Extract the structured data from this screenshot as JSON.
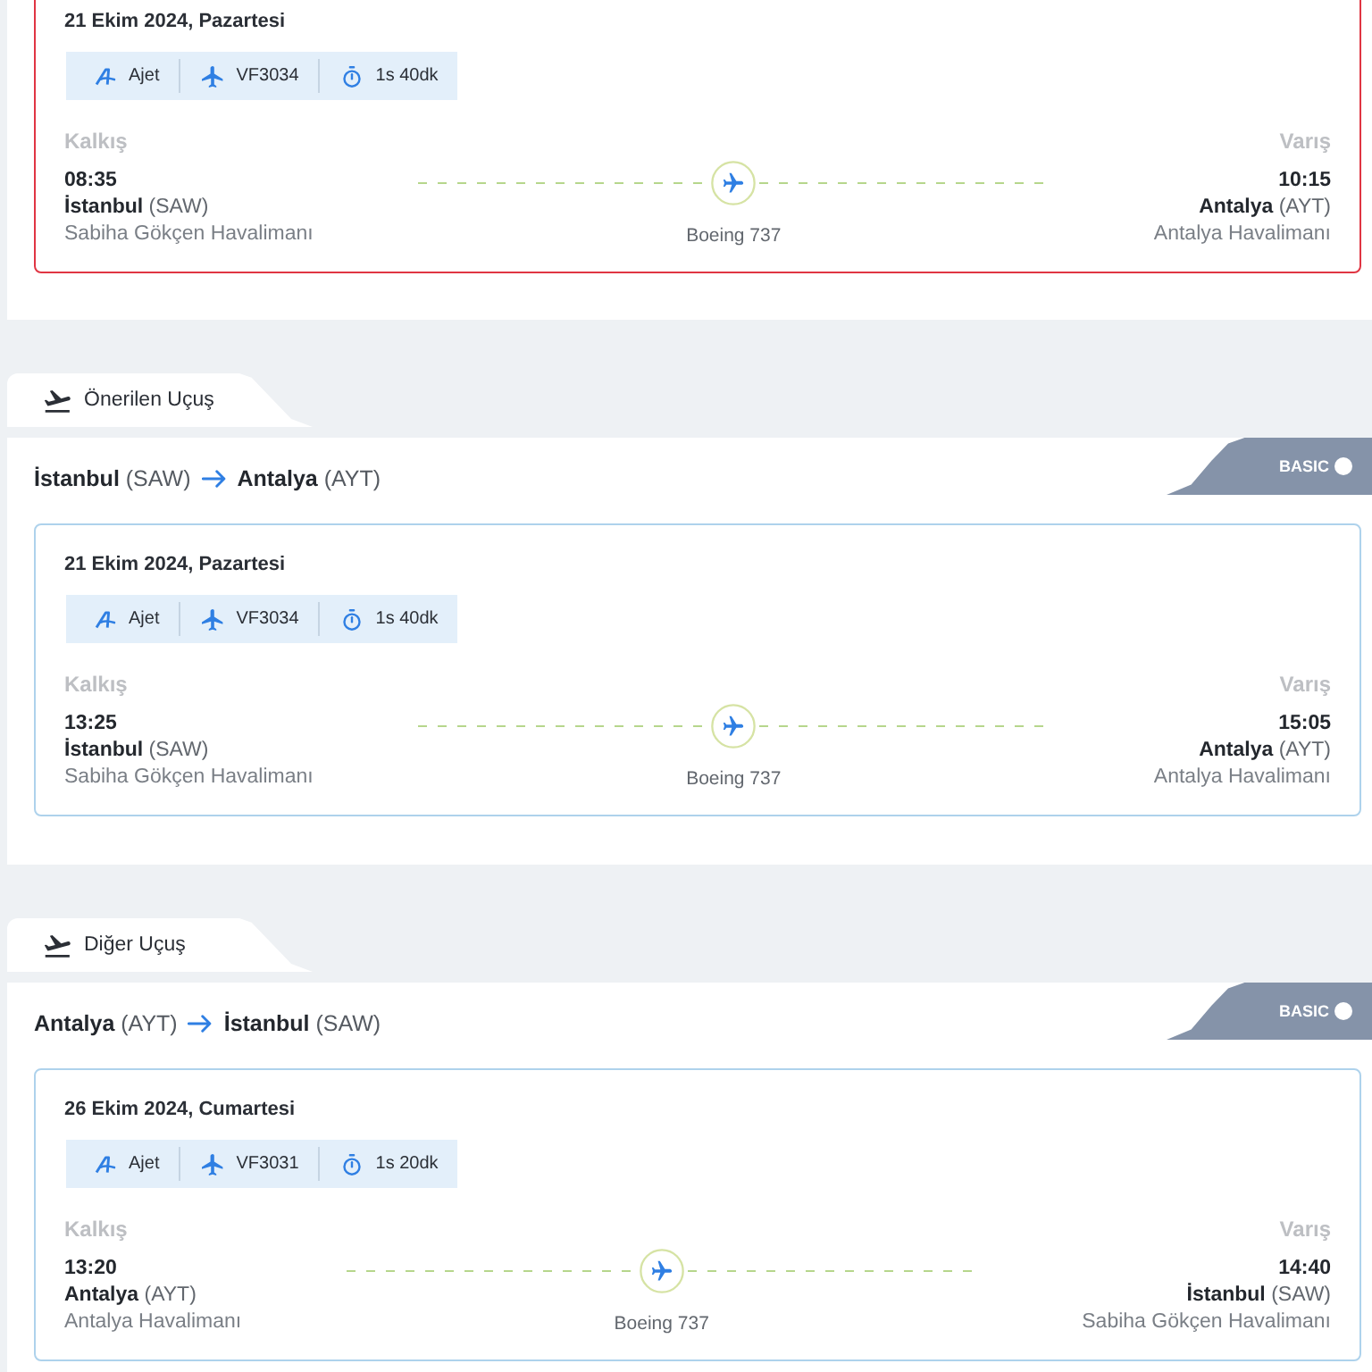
{
  "sections": [
    {
      "flights": [
        {
          "selected": true,
          "date": "21 Ekim 2024, Pazartesi",
          "airline": "Ajet",
          "flight_no": "VF3034",
          "duration": "1s 40dk",
          "departure": {
            "label": "Kalkış",
            "time": "08:35",
            "city": "**İstanbul** (SAW)",
            "airport": "Sabiha Gökçen Havalimanı"
          },
          "aircraft": "Boeing 737",
          "arrival": {
            "label": "Varış",
            "time": "10:15",
            "city": "**Antalya** (AYT)",
            "airport": "Antalya Havalimanı"
          }
        }
      ]
    },
    {
      "tab": {
        "label": "Önerilen Uçuş"
      },
      "route": {
        "from": "**İstanbul** (SAW)",
        "to": "**Antalya** (AYT)"
      },
      "fare_badge": {
        "label": "BASIC"
      },
      "flights": [
        {
          "selected": false,
          "date": "21 Ekim 2024, Pazartesi",
          "airline": "Ajet",
          "flight_no": "VF3034",
          "duration": "1s 40dk",
          "departure": {
            "label": "Kalkış",
            "time": "13:25",
            "city": "**İstanbul** (SAW)",
            "airport": "Sabiha Gökçen Havalimanı"
          },
          "aircraft": "Boeing 737",
          "arrival": {
            "label": "Varış",
            "time": "15:05",
            "city": "**Antalya** (AYT)",
            "airport": "Antalya Havalimanı"
          }
        }
      ]
    },
    {
      "tab": {
        "label": "Diğer Uçuş"
      },
      "route": {
        "from": "**Antalya** (AYT)",
        "to": "**İstanbul** (SAW)"
      },
      "fare_badge": {
        "label": "BASIC"
      },
      "flights": [
        {
          "selected": false,
          "date": "26 Ekim 2024, Cumartesi",
          "airline": "Ajet",
          "flight_no": "VF3031",
          "duration": "1s 20dk",
          "departure": {
            "label": "Kalkış",
            "time": "13:20",
            "city": "**Antalya** (AYT)",
            "airport": "Antalya Havalimanı"
          },
          "aircraft": "Boeing 737",
          "arrival": {
            "label": "Varış",
            "time": "14:40",
            "city": "**İstanbul** (SAW)",
            "airport": "Sabiha Gökçen Havalimanı"
          }
        }
      ]
    }
  ]
}
